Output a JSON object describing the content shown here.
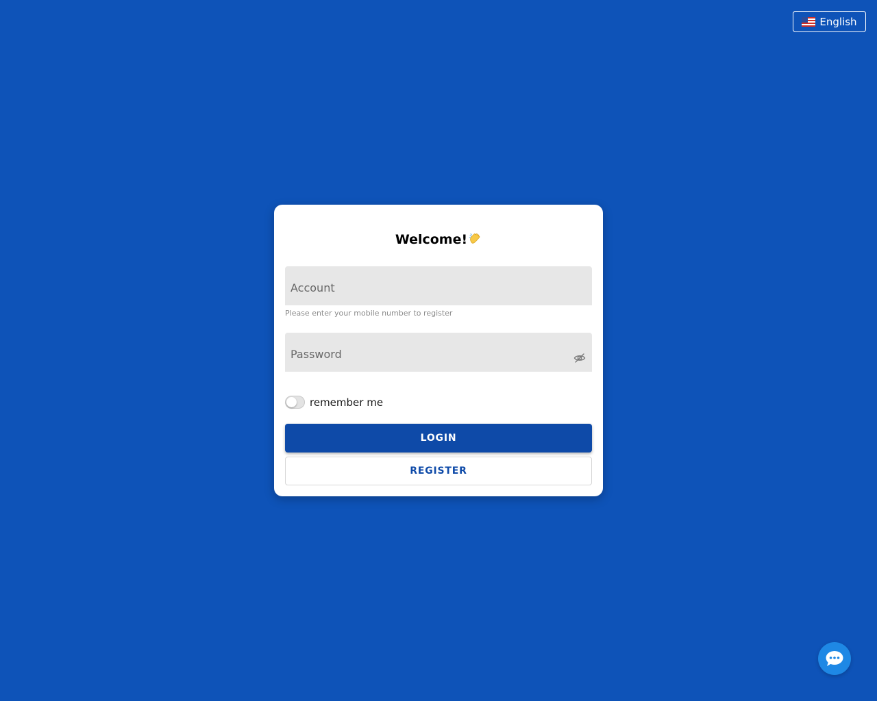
{
  "language": {
    "label": "English",
    "flag_icon": "us-flag-icon"
  },
  "login_card": {
    "title": "Welcome!",
    "title_icon": "clapping-hands-icon",
    "account": {
      "placeholder": "Account",
      "value": "",
      "hint": "Please enter your mobile number to register"
    },
    "password": {
      "placeholder": "Password",
      "value": "",
      "visibility_icon": "eye-off-icon"
    },
    "remember_me": {
      "label": "remember me",
      "checked": false
    },
    "login_label": "LOGIN",
    "register_label": "REGISTER"
  },
  "chat": {
    "icon": "chat-bubble-icon"
  },
  "colors": {
    "background": "#0e53b8",
    "primary": "#0e4aa8",
    "chat": "#1e88e5"
  }
}
